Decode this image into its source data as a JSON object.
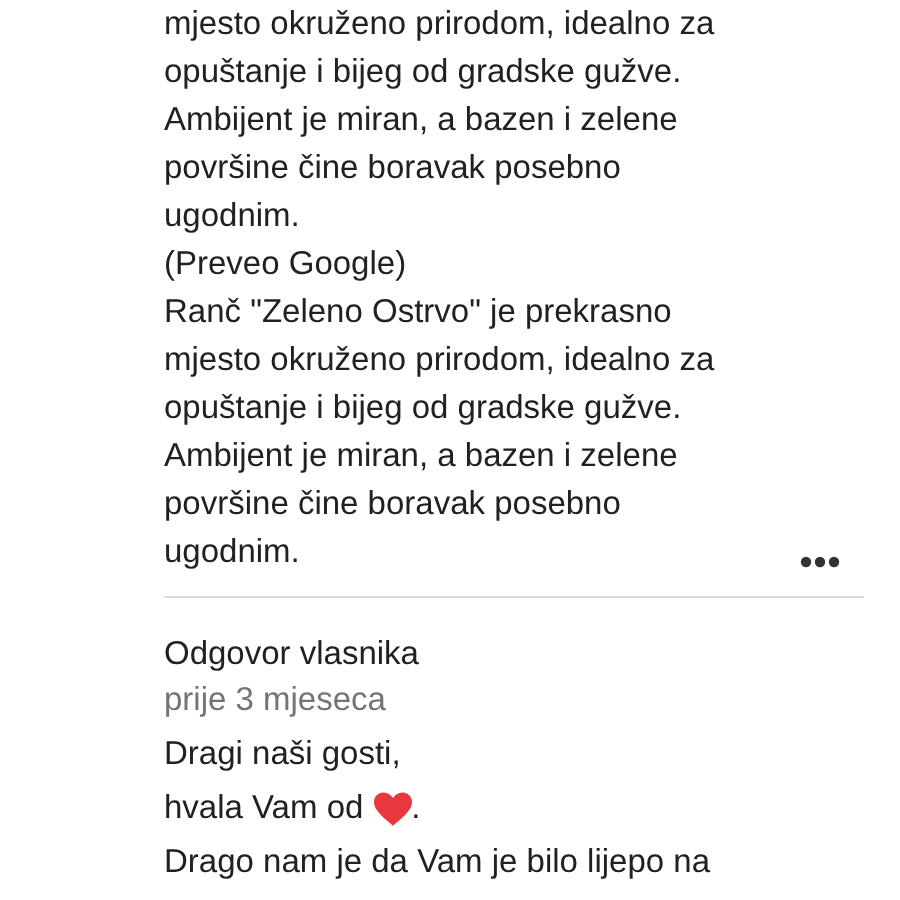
{
  "review": {
    "text": "mjesto okruženo prirodom, idealno za opuštanje i bijeg od gradske gužve. Ambijent je miran, a bazen i zelene površine čine boravak posebno ugodnim.",
    "translation_note": "(Preveo Google)",
    "original_text": "Ranč \"Zeleno Ostrvo\" je prekrasno mjesto okruženo prirodom, idealno za opuštanje i bijeg od gradske gužve. Ambijent je miran, a bazen i zelene površine čine boravak posebno ugodnim."
  },
  "owner_reply": {
    "title": "Odgovor vlasnika",
    "time": "prije 3 mjeseca",
    "paragraphs": [
      {
        "kind": "text",
        "text": "Dragi naši gosti,"
      },
      {
        "kind": "heart",
        "before": "hvala Vam od",
        "after": "."
      },
      {
        "kind": "text",
        "text": "Drago nam je da Vam je bilo lijepo na"
      }
    ]
  }
}
